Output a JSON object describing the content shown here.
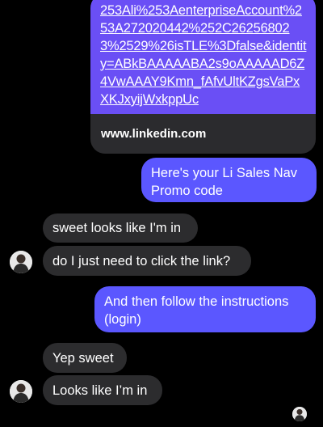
{
  "link_preview": {
    "url_text": "253Ali%253AenterpriseAccount%253A272020442%252C262568023%2529%26isTLE%3Dfalse&identity=ABkBAAAAABA2s9oAAAAAD6Z4VwAAAY9Kmn_fAfvUltKZgsVaPxXKJxyijWxkppUc",
    "domain": "www.linkedin.com"
  },
  "messages": [
    {
      "side": "sent",
      "text": "Here's your Li Sales Nav Promo code"
    },
    {
      "side": "received",
      "text": "sweet looks like I'm in"
    },
    {
      "side": "received",
      "text": "do I just need to click the link?"
    },
    {
      "side": "sent",
      "text": "And then follow the instructions (login)"
    },
    {
      "side": "received",
      "text": "Yep sweet"
    },
    {
      "side": "received",
      "text": "Looks like I’m in"
    }
  ],
  "colors": {
    "sent_bubble": "#5b57ff",
    "received_bubble": "#2c2c2e",
    "link_card": "#6a4ff5",
    "background": "#000000"
  }
}
